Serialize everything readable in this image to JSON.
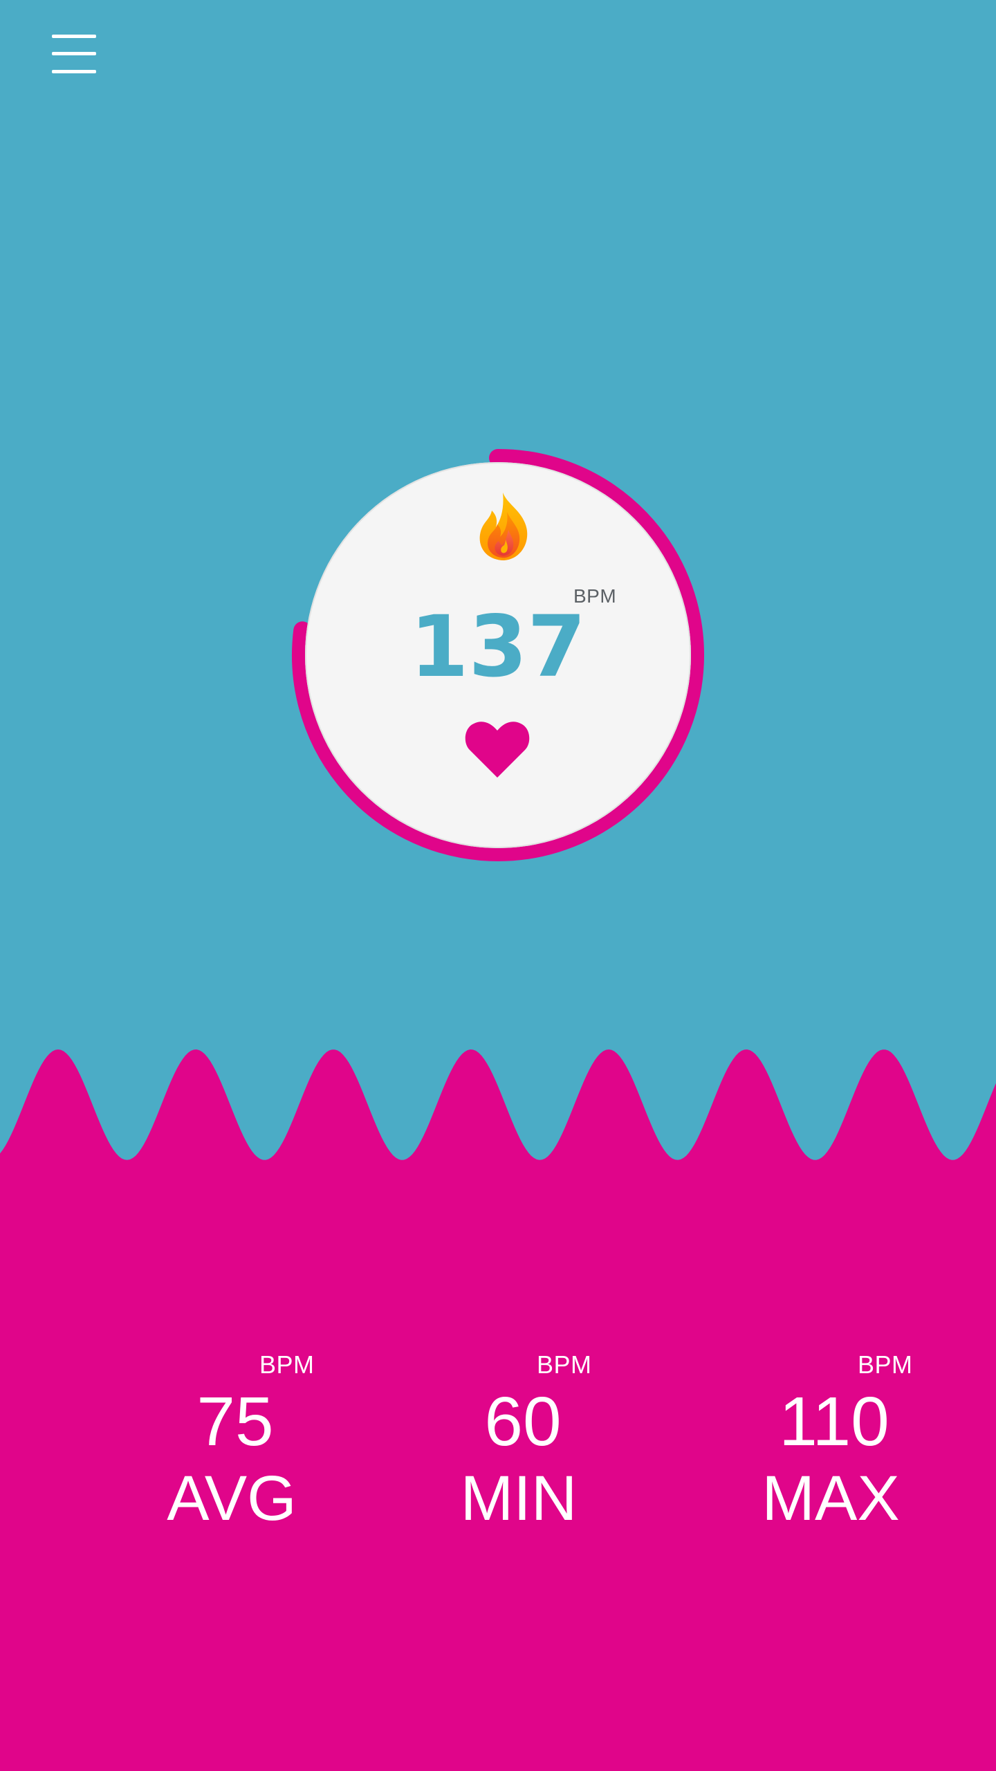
{
  "header": {
    "menu_icon": "hamburger-menu-icon"
  },
  "gauge": {
    "value": "137",
    "unit": "BPM",
    "progress_fraction": 0.77,
    "top_icon": "flame-icon",
    "bottom_icon": "heart-icon",
    "ring_color": "#E0058A",
    "value_color": "#4BACC6",
    "background_color": "#F5F5F5"
  },
  "stats": [
    {
      "value": "75",
      "unit": "BPM",
      "label": "AVG"
    },
    {
      "value": "60",
      "unit": "BPM",
      "label": "MIN"
    },
    {
      "value": "110",
      "unit": "BPM",
      "label": "MAX"
    }
  ],
  "colors": {
    "top_background": "#4BACC6",
    "bottom_background": "#E0058A",
    "text_light": "#FFFFFF"
  }
}
